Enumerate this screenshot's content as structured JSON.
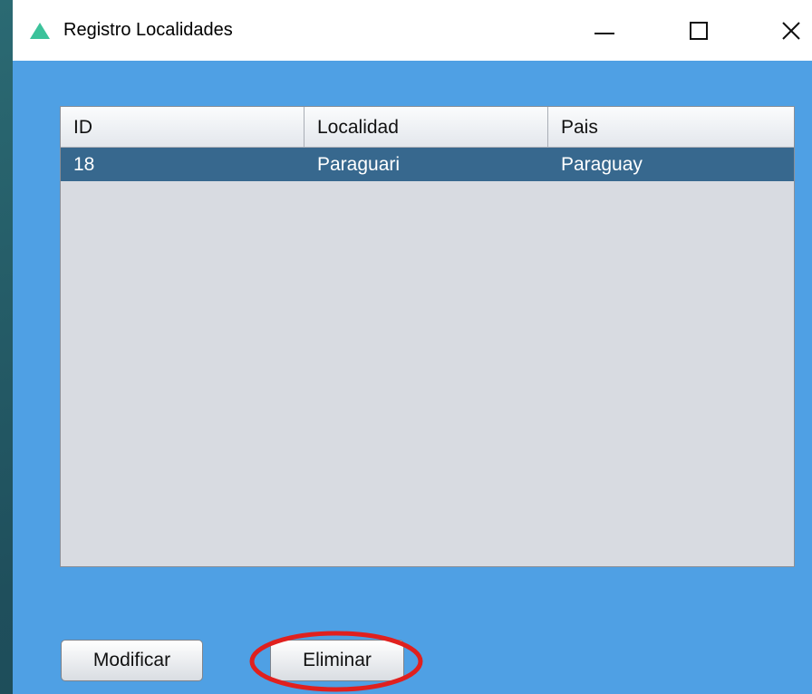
{
  "window": {
    "title": "Registro Localidades",
    "icon": "triangle-app-icon",
    "controls": [
      "minimize",
      "maximize",
      "close"
    ]
  },
  "table": {
    "columns": [
      "ID",
      "Localidad",
      "Pais"
    ],
    "rows": [
      {
        "id": "18",
        "localidad": "Paraguari",
        "pais": "Paraguay",
        "selected": true
      }
    ]
  },
  "buttons": {
    "modificar": "Modificar",
    "eliminar": "Eliminar"
  },
  "colors": {
    "window_background": "#4fa0e4",
    "selected_row": "#37688e",
    "annotation_circle": "#e0201e",
    "app_icon": "#3cc29b"
  }
}
